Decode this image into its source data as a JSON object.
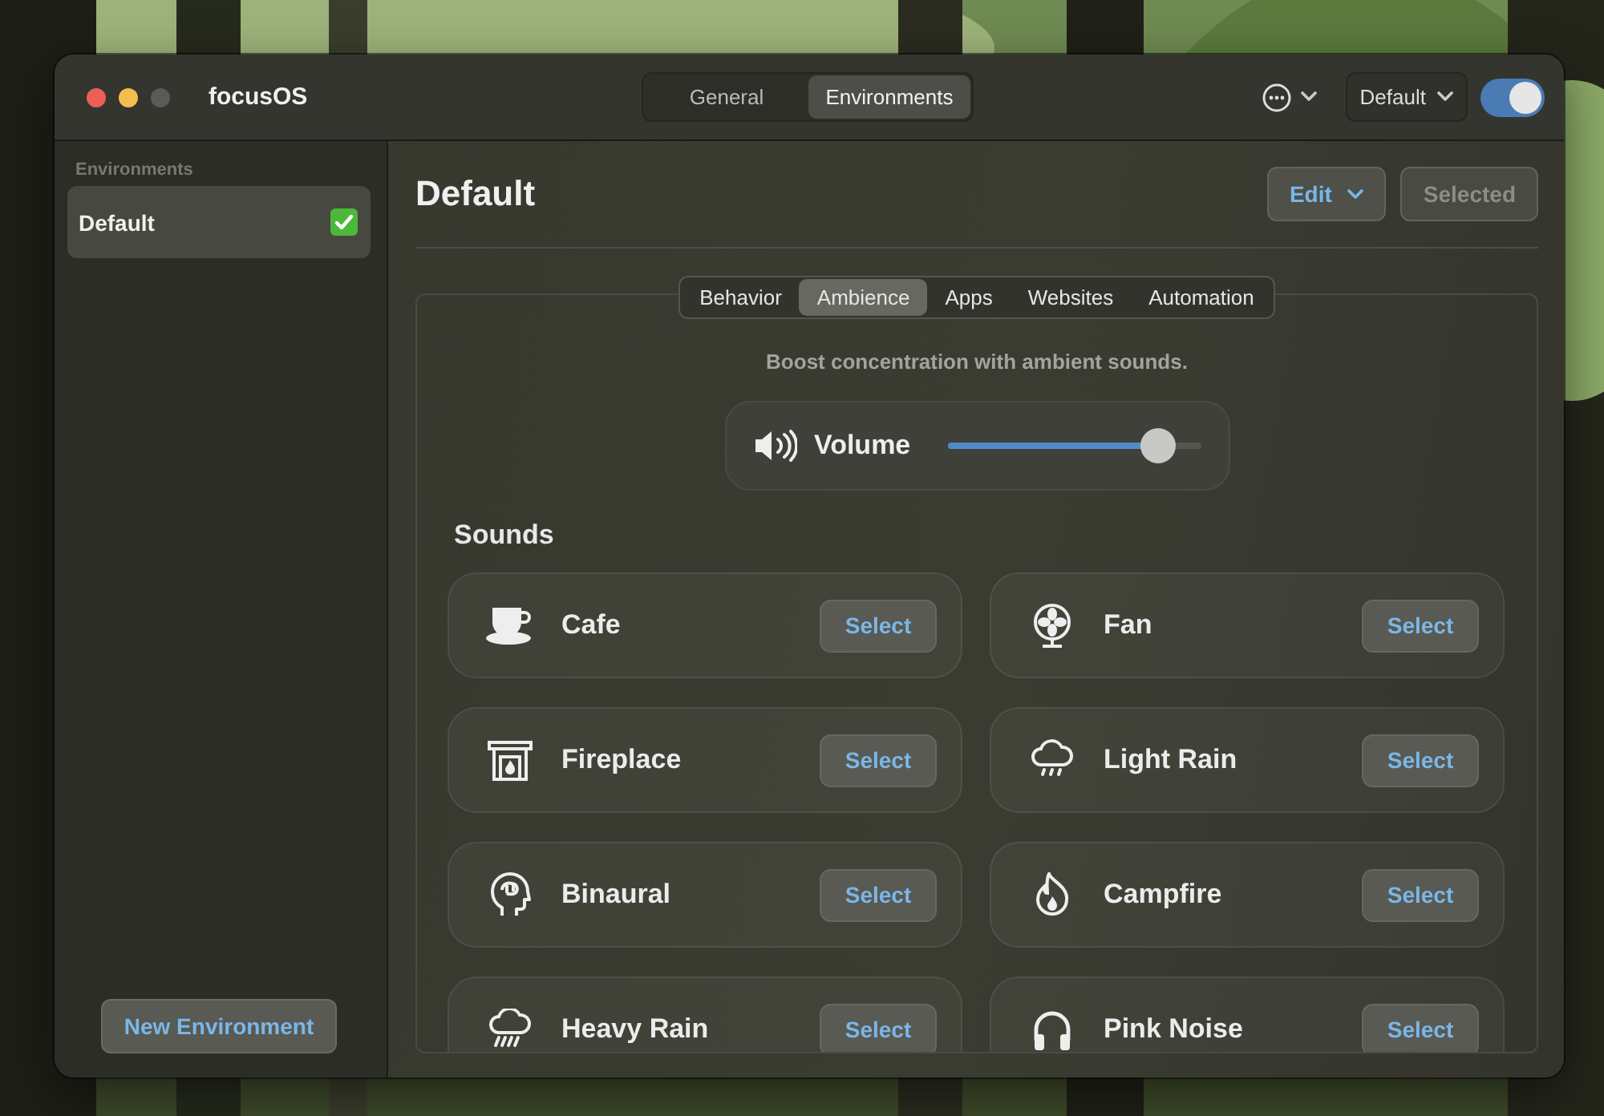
{
  "window": {
    "title": "focusOS"
  },
  "top_tabs": [
    {
      "label": "General",
      "selected": false
    },
    {
      "label": "Environments",
      "selected": true
    }
  ],
  "profile_menu": {
    "label": "Default"
  },
  "toggle": {
    "on": true
  },
  "sidebar": {
    "heading": "Environments",
    "items": [
      {
        "label": "Default",
        "selected": true
      }
    ],
    "new_button": "New Environment"
  },
  "main": {
    "title": "Default",
    "edit_button": "Edit",
    "selected_button": {
      "label": "Selected",
      "disabled": true
    },
    "tabs": [
      {
        "label": "Behavior",
        "selected": false
      },
      {
        "label": "Ambience",
        "selected": true
      },
      {
        "label": "Apps",
        "selected": false
      },
      {
        "label": "Websites",
        "selected": false
      },
      {
        "label": "Automation",
        "selected": false
      }
    ],
    "subtitle": "Boost concentration with ambient sounds.",
    "volume": {
      "label": "Volume",
      "level": 0.83
    },
    "sounds_heading": "Sounds",
    "sounds": [
      {
        "name": "Cafe",
        "kind": "cup",
        "button": "Select"
      },
      {
        "name": "Fan",
        "kind": "fan",
        "button": "Select"
      },
      {
        "name": "Fireplace",
        "kind": "fireplace",
        "button": "Select"
      },
      {
        "name": "Light Rain",
        "kind": "drizzle",
        "button": "Select"
      },
      {
        "name": "Binaural",
        "kind": "brain",
        "button": "Select"
      },
      {
        "name": "Campfire",
        "kind": "flame",
        "button": "Select"
      },
      {
        "name": "Heavy Rain",
        "kind": "rain",
        "button": "Select"
      },
      {
        "name": "Pink Noise",
        "kind": "headphones",
        "button": "Select"
      }
    ]
  }
}
